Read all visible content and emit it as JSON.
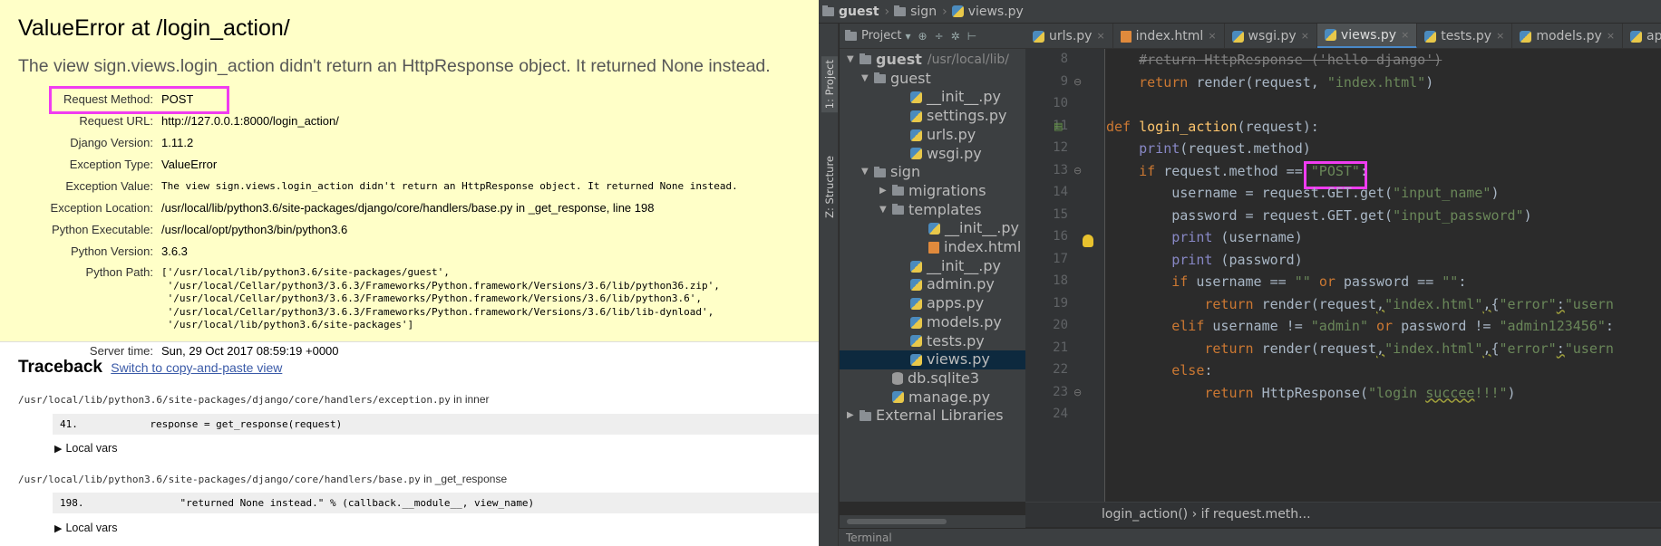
{
  "django": {
    "title": "ValueError at /login_action/",
    "message": "The view sign.views.login_action didn't return an HttpResponse object. It returned None instead.",
    "meta": [
      {
        "key": "Request Method:",
        "value": "POST"
      },
      {
        "key": "Request URL:",
        "value": "http://127.0.0.1:8000/login_action/"
      },
      {
        "key": "Django Version:",
        "value": "1.11.2"
      },
      {
        "key": "Exception Type:",
        "value": "ValueError"
      },
      {
        "key": "Exception Value:",
        "value": "The view sign.views.login_action didn't return an HttpResponse object. It returned None instead."
      },
      {
        "key": "Exception Location:",
        "value": "/usr/local/lib/python3.6/site-packages/django/core/handlers/base.py in _get_response, line 198"
      },
      {
        "key": "Python Executable:",
        "value": "/usr/local/opt/python3/bin/python3.6"
      },
      {
        "key": "Python Version:",
        "value": "3.6.3"
      },
      {
        "key": "Python Path:",
        "value": "['/usr/local/lib/python3.6/site-packages/guest',\n '/usr/local/Cellar/python3/3.6.3/Frameworks/Python.framework/Versions/3.6/lib/python36.zip',\n '/usr/local/Cellar/python3/3.6.3/Frameworks/Python.framework/Versions/3.6/lib/python3.6',\n '/usr/local/Cellar/python3/3.6.3/Frameworks/Python.framework/Versions/3.6/lib/lib-dynload',\n '/usr/local/lib/python3.6/site-packages']"
      },
      {
        "key": "Server time:",
        "value": "Sun, 29 Oct 2017 08:59:19 +0000"
      }
    ],
    "traceback": {
      "title": "Traceback",
      "copy_link": "Switch to copy-and-paste view",
      "frames": [
        {
          "file": "/usr/local/lib/python3.6/site-packages/django/core/handlers/exception.py",
          "func": "in inner",
          "code": "41.            response = get_response(request)",
          "local_vars": "Local vars"
        },
        {
          "file": "/usr/local/lib/python3.6/site-packages/django/core/handlers/base.py",
          "func": "in _get_response",
          "code": "198.                \"returned None instead.\" % (callback.__module__, view_name)",
          "local_vars": "Local vars"
        }
      ]
    }
  },
  "ide": {
    "breadcrumbs": [
      "guest",
      "sign",
      "views.py"
    ],
    "side_tabs": {
      "project": "1: Project",
      "structure": "Z: Structure"
    },
    "project_header": {
      "label": "Project",
      "icons": [
        "⊕",
        "÷",
        "✲",
        "⊢"
      ]
    },
    "tabs": [
      {
        "label": "urls.py",
        "icon": "python-file-icon"
      },
      {
        "label": "index.html",
        "icon": "html-file-icon"
      },
      {
        "label": "wsgi.py",
        "icon": "python-file-icon"
      },
      {
        "label": "views.py",
        "icon": "python-file-icon",
        "active": true
      },
      {
        "label": "tests.py",
        "icon": "python-file-icon"
      },
      {
        "label": "models.py",
        "icon": "python-file-icon"
      },
      {
        "label": "apps.py",
        "icon": "python-file-icon"
      }
    ],
    "tree": [
      {
        "label": "guest",
        "extra": "/usr/local/lib/",
        "indent": 0,
        "arrow": "▼",
        "icon": "folder",
        "bold": true
      },
      {
        "label": "guest",
        "indent": 1,
        "arrow": "▼",
        "icon": "folder"
      },
      {
        "label": "__init__.py",
        "indent": 3,
        "icon": "py"
      },
      {
        "label": "settings.py",
        "indent": 3,
        "icon": "py"
      },
      {
        "label": "urls.py",
        "indent": 3,
        "icon": "py"
      },
      {
        "label": "wsgi.py",
        "indent": 3,
        "icon": "py"
      },
      {
        "label": "sign",
        "indent": 1,
        "arrow": "▼",
        "icon": "folder"
      },
      {
        "label": "migrations",
        "indent": 2,
        "arrow": "▶",
        "icon": "folder"
      },
      {
        "label": "templates",
        "indent": 2,
        "arrow": "▼",
        "icon": "folder"
      },
      {
        "label": "__init__.py",
        "indent": 4,
        "icon": "py"
      },
      {
        "label": "index.html",
        "indent": 4,
        "icon": "html"
      },
      {
        "label": "__init__.py",
        "indent": 3,
        "icon": "py"
      },
      {
        "label": "admin.py",
        "indent": 3,
        "icon": "py"
      },
      {
        "label": "apps.py",
        "indent": 3,
        "icon": "py"
      },
      {
        "label": "models.py",
        "indent": 3,
        "icon": "py"
      },
      {
        "label": "tests.py",
        "indent": 3,
        "icon": "py"
      },
      {
        "label": "views.py",
        "indent": 3,
        "icon": "py",
        "selected": true
      },
      {
        "label": "db.sqlite3",
        "indent": 2,
        "icon": "db"
      },
      {
        "label": "manage.py",
        "indent": 2,
        "icon": "py"
      },
      {
        "label": "External Libraries",
        "indent": 0,
        "arrow": "▶",
        "icon": "lib"
      }
    ],
    "line_numbers": [
      "8",
      "9",
      "10",
      "11",
      "12",
      "13",
      "14",
      "15",
      "16",
      "17",
      "18",
      "19",
      "20",
      "21",
      "22",
      "23",
      "24"
    ],
    "code": [
      [
        {
          "t": "    "
        },
        {
          "t": "#return HttpResponse ('hello django')",
          "c": "cm"
        }
      ],
      [
        {
          "t": "    "
        },
        {
          "t": "return",
          "c": "kw"
        },
        {
          "t": " render(request, "
        },
        {
          "t": "\"index.html\"",
          "c": "str"
        },
        {
          "t": ")"
        }
      ],
      [],
      [
        {
          "t": "def",
          "c": "kw"
        },
        {
          "t": " "
        },
        {
          "t": "login_action",
          "c": "fn"
        },
        {
          "t": "(request):"
        }
      ],
      [
        {
          "t": "    "
        },
        {
          "t": "print",
          "c": "bi"
        },
        {
          "t": "(request.method)"
        }
      ],
      [
        {
          "t": "    "
        },
        {
          "t": "if",
          "c": "kw"
        },
        {
          "t": " request.method == "
        },
        {
          "t": "\"POST\"",
          "c": "str"
        },
        {
          "t": ":"
        }
      ],
      [
        {
          "t": "        username = request.GET.get("
        },
        {
          "t": "\"input_name\"",
          "c": "str"
        },
        {
          "t": ")"
        }
      ],
      [
        {
          "t": "        password = request.GET.get("
        },
        {
          "t": "\"input_password\"",
          "c": "str"
        },
        {
          "t": ")"
        }
      ],
      [
        {
          "t": "        "
        },
        {
          "t": "print",
          "c": "bi"
        },
        {
          "t": " (username)"
        }
      ],
      [
        {
          "t": "        "
        },
        {
          "t": "print",
          "c": "bi"
        },
        {
          "t": " (password)"
        }
      ],
      [
        {
          "t": "        "
        },
        {
          "t": "if",
          "c": "kw"
        },
        {
          "t": " username == "
        },
        {
          "t": "\"\"",
          "c": "str"
        },
        {
          "t": " "
        },
        {
          "t": "or",
          "c": "kw"
        },
        {
          "t": " password == "
        },
        {
          "t": "\"\"",
          "c": "str"
        },
        {
          "t": ":"
        }
      ],
      [
        {
          "t": "            "
        },
        {
          "t": "return",
          "c": "kw"
        },
        {
          "t": " render(request"
        },
        {
          "t": ",",
          "c": "sq"
        },
        {
          "t": "\"index.html\"",
          "c": "str"
        },
        {
          "t": ",",
          "c": "sq"
        },
        {
          "t": "{"
        },
        {
          "t": "\"error\"",
          "c": "str"
        },
        {
          "t": ":",
          "c": "sq"
        },
        {
          "t": "\"usern",
          "c": "str"
        }
      ],
      [
        {
          "t": "        "
        },
        {
          "t": "elif",
          "c": "kw"
        },
        {
          "t": " username != "
        },
        {
          "t": "\"admin\"",
          "c": "str"
        },
        {
          "t": " "
        },
        {
          "t": "or",
          "c": "kw"
        },
        {
          "t": " password != "
        },
        {
          "t": "\"admin123456\"",
          "c": "str"
        },
        {
          "t": ":"
        }
      ],
      [
        {
          "t": "            "
        },
        {
          "t": "return",
          "c": "kw"
        },
        {
          "t": " render(request"
        },
        {
          "t": ",",
          "c": "sq"
        },
        {
          "t": "\"index.html\"",
          "c": "str"
        },
        {
          "t": ",",
          "c": "sq"
        },
        {
          "t": "{"
        },
        {
          "t": "\"error\"",
          "c": "str"
        },
        {
          "t": ":",
          "c": "sq"
        },
        {
          "t": "\"usern",
          "c": "str"
        }
      ],
      [
        {
          "t": "        "
        },
        {
          "t": "else",
          "c": "kw"
        },
        {
          "t": ":"
        }
      ],
      [
        {
          "t": "            "
        },
        {
          "t": "return",
          "c": "kw"
        },
        {
          "t": " HttpResponse("
        },
        {
          "t": "\"login ",
          "c": "str"
        },
        {
          "t": "succee",
          "c": "str sq"
        },
        {
          "t": "!!!\"",
          "c": "str"
        },
        {
          "t": ")"
        }
      ],
      []
    ],
    "editor_breadcrumb": "login_action()  ›  if request.meth...",
    "bottom_tool": "Terminal",
    "colors": {
      "highlight": "#f03cf0",
      "keyword": "#cc7832",
      "string": "#6a8759",
      "function": "#ffc66d"
    }
  }
}
